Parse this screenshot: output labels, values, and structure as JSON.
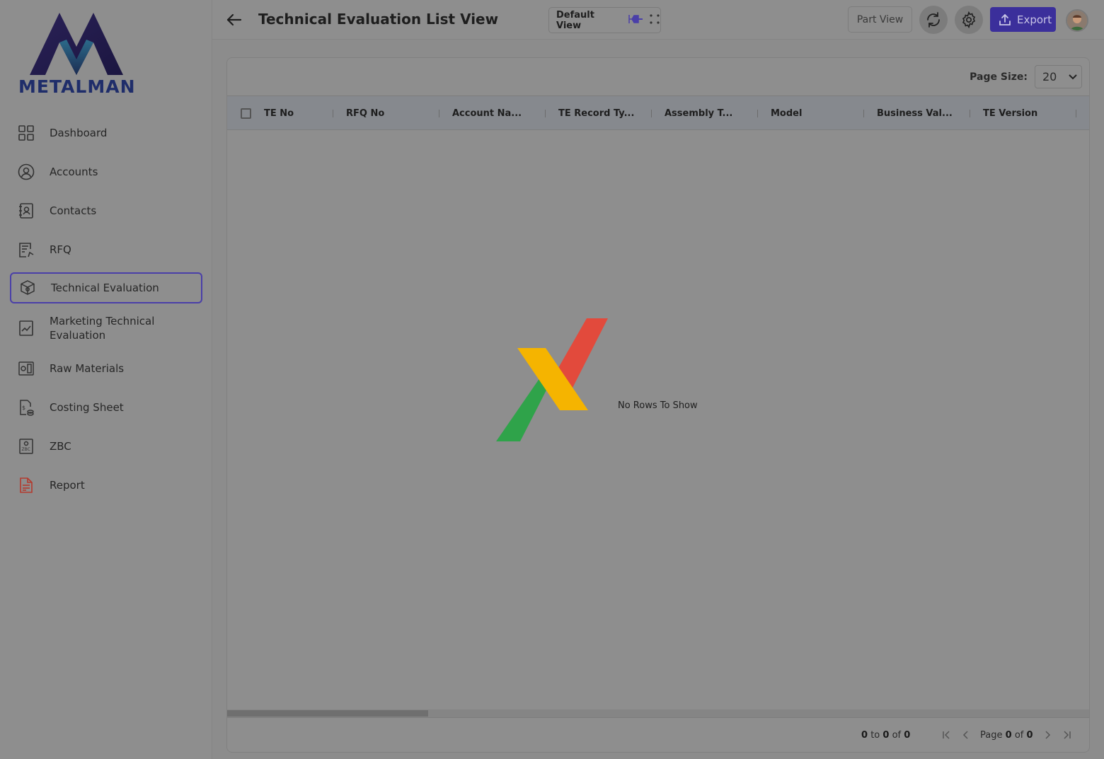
{
  "brand": {
    "name": "METALMAN"
  },
  "sidebar": {
    "items": [
      {
        "label": "Dashboard",
        "icon": "dashboard-icon"
      },
      {
        "label": "Accounts",
        "icon": "user-circle-icon"
      },
      {
        "label": "Contacts",
        "icon": "contact-book-icon"
      },
      {
        "label": "RFQ",
        "icon": "rfq-document-icon"
      },
      {
        "label": "Technical Evaluation",
        "icon": "technical-evaluation-icon",
        "active": true
      },
      {
        "label": "Marketing Technical Evaluation",
        "icon": "chart-document-icon"
      },
      {
        "label": "Raw Materials",
        "icon": "raw-materials-icon"
      },
      {
        "label": "Costing Sheet",
        "icon": "costing-sheet-icon"
      },
      {
        "label": "ZBC",
        "icon": "zbc-icon"
      },
      {
        "label": "Report",
        "icon": "report-icon"
      }
    ]
  },
  "header": {
    "title": "Technical Evaluation List View",
    "view_select": "Default View",
    "part_view": "Part View",
    "export": "Export"
  },
  "grid": {
    "page_size_label": "Page Size:",
    "page_size_value": "20",
    "columns": [
      "TE No",
      "RFQ No",
      "Account Na...",
      "TE Record Ty...",
      "Assembly T...",
      "Model",
      "Business Val...",
      "TE Version"
    ],
    "empty_message": "No Rows To Show",
    "footer": {
      "from": "0",
      "to_word": "to",
      "to": "0",
      "of_word": "of",
      "total": "0",
      "page_word": "Page",
      "page": "0",
      "page_of_word": "of",
      "page_total": "0"
    }
  },
  "colors": {
    "accent": "#3b2f9b",
    "active_border": "#4a3fa8",
    "brand_dark": "#1f2d6a",
    "empty_logo_red": "#e24a3c",
    "empty_logo_yellow": "#f5b400",
    "empty_logo_green": "#2fa34a"
  }
}
